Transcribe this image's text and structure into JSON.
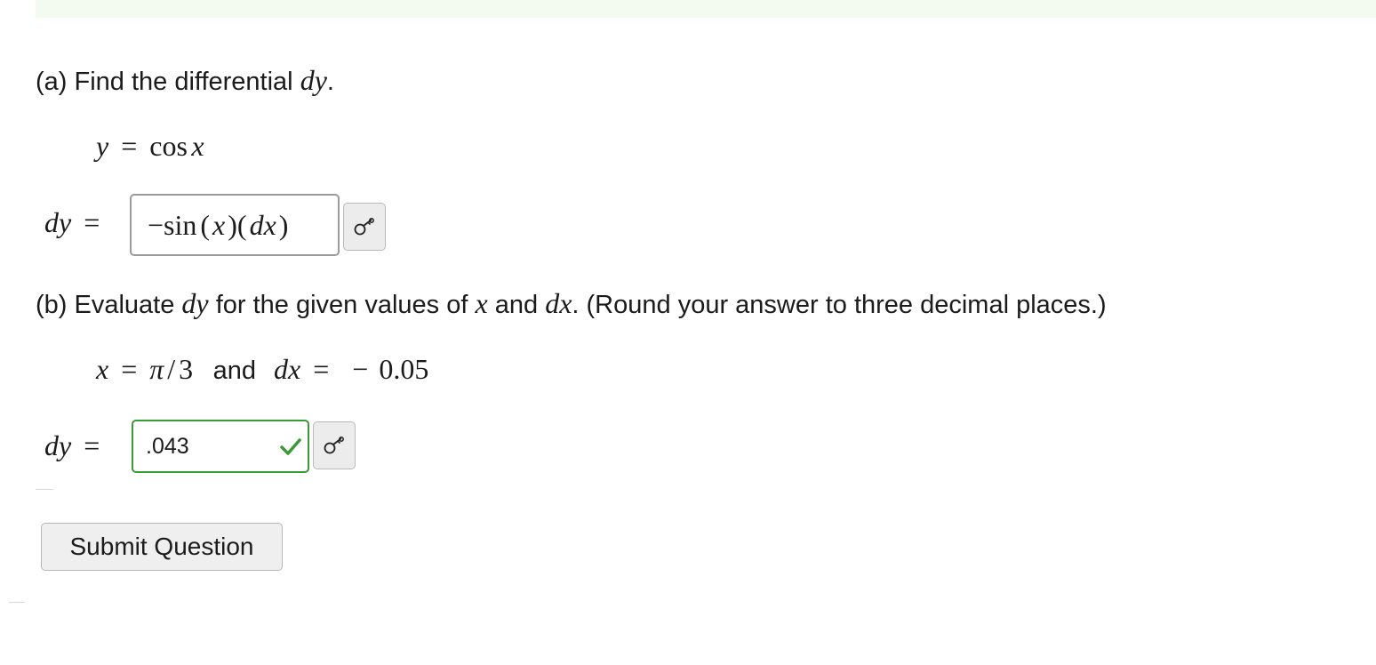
{
  "part_a": {
    "prompt_text": "(a) Find the differential",
    "prompt_var": "dy",
    "prompt_end": ".",
    "given_lhs": "y",
    "given_op": "=",
    "given_func": "cos",
    "given_arg": "x",
    "answer_label": "dy",
    "answer_op": "=",
    "answer_minus": "−",
    "answer_func": "sin",
    "answer_lparen": "(",
    "answer_x": "x",
    "answer_rparen": ")",
    "answer_lparen2": "(",
    "answer_dx": "dx",
    "answer_rparen2": ")"
  },
  "part_b": {
    "prompt_text_1": "(b) Evaluate",
    "prompt_var_dy": "dy",
    "prompt_text_2": "for the given values of",
    "prompt_var_x": "x",
    "prompt_text_3": "and",
    "prompt_var_dx": "dx",
    "prompt_text_4": ". (Round your answer to three decimal places.)",
    "given_x": "x",
    "given_op1": "=",
    "given_pi": "π",
    "given_slash": "/",
    "given_three": "3",
    "given_and": "and",
    "given_dx": "dx",
    "given_op2": "=",
    "given_minus": "−",
    "given_value": "0.05",
    "answer_label": "dy",
    "answer_op": "=",
    "answer_value": ".043",
    "answer_status": "correct"
  },
  "submit_label": "Submit Question",
  "icons": {
    "key": "key-icon",
    "check": "check-icon"
  },
  "colors": {
    "correct": "#3a9a35",
    "top_band": "#f3fbf1"
  }
}
